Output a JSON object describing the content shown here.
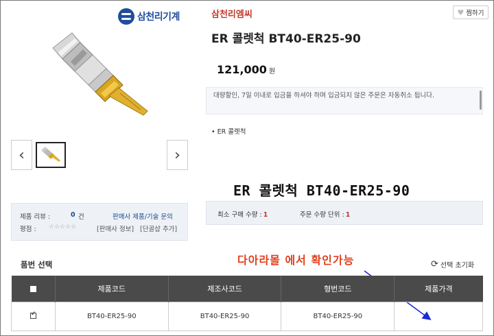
{
  "brand": {
    "logo_text": "삼천리기계",
    "logo_color": "#1f4e9c"
  },
  "product": {
    "seller": "삼천리엠씨",
    "title": "ER 콜렛척 BT40-ER25-90",
    "price": "121,000",
    "price_unit": "원",
    "notice": "대량할인, 7일 이내로 입금을 하셔야 하며 입금되지 않은 주문은 자동취소 됩니다.",
    "bullet": "ER 콜렛척",
    "big_title": "ER 콜렛척 BT40-ER25-90"
  },
  "wish_button": {
    "label": "찜하기",
    "icon": "heart-icon"
  },
  "gallery": {
    "prev_icon": "chevron-left-icon",
    "next_icon": "chevron-right-icon"
  },
  "review": {
    "review_label": "제품 리뷰 :",
    "review_count": "0",
    "review_unit": "건",
    "rating_label": "평점 :",
    "stars": "☆☆☆☆☆",
    "inquiry_link": "판매사 제품/기술 문의",
    "seller_info_link": "[판매사 정보]",
    "add_fav_link": "[단골샵 추가]"
  },
  "quantity": {
    "min_label": "최소 구매 수량 :",
    "min_value": "1",
    "unit_label": "주문 수량 단위 :",
    "unit_value": "1"
  },
  "annotation": {
    "text": "다아라몰 에서 확인가능",
    "color": "#e23e1b"
  },
  "options": {
    "section_title": "품번 선택",
    "reset_label": "선택 초기화",
    "columns": [
      "제품코드",
      "제조사코드",
      "형번코드",
      "제품가격"
    ],
    "rows": [
      {
        "checked": true,
        "product_code": "BT40-ER25-90",
        "maker_code": "BT40-ER25-90",
        "model_code": "BT40-ER25-90",
        "price": ""
      }
    ]
  }
}
